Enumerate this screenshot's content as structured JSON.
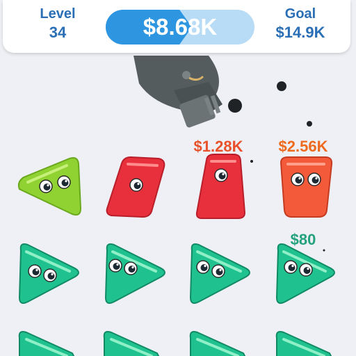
{
  "hud": {
    "level_label": "Level",
    "level_value": "34",
    "goal_label": "Goal",
    "goal_value": "$14.9K",
    "current_value": "$8.68K",
    "progress_fraction": 0.58
  },
  "price_tags": {
    "red_piece": "$1.28K",
    "orange_piece": "$2.56K",
    "green_piece": "$80"
  },
  "colors": {
    "hud_text": "#2a6fb5",
    "progress_fill": "#2e96e0",
    "progress_track": "#b8dcf5",
    "lime_blob": "#8fd232",
    "red_blob": "#e8303c",
    "orange_blob": "#f25a3a",
    "teal_blob": "#1fc28e",
    "cannon": "#555c5e"
  },
  "grid": {
    "rows": [
      [
        "lime-triangle",
        "red-parallelogram",
        "red-trapezoid",
        "orange-trapezoid"
      ],
      [
        "teal-triangle",
        "teal-triangle",
        "teal-triangle",
        "teal-triangle"
      ],
      [
        "teal-triangle",
        "teal-triangle",
        "teal-triangle",
        "teal-triangle"
      ]
    ]
  }
}
